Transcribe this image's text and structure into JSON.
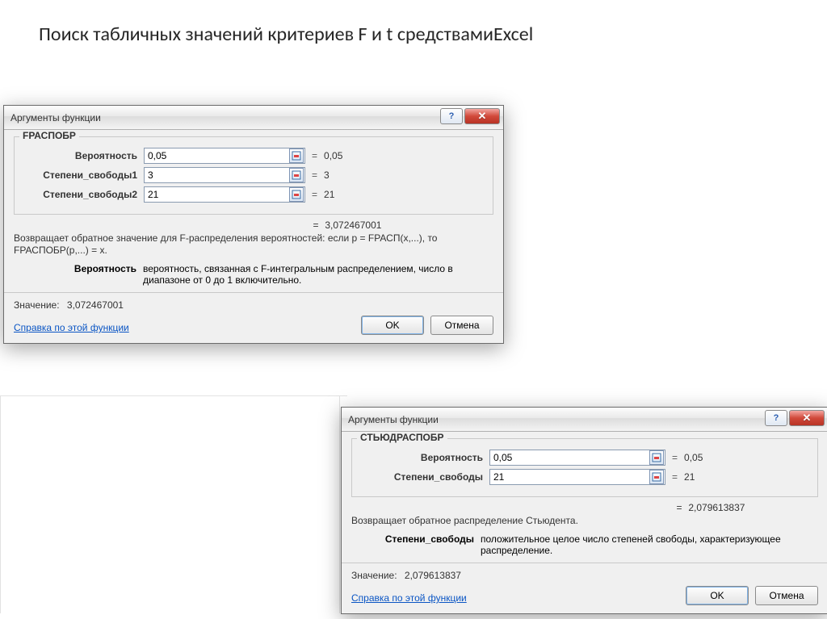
{
  "page_title": "Поиск табличных значений критериев F и t средствамиExcel",
  "dialog1": {
    "window_title": "Аргументы функции",
    "function_name": "FРАСПОБР",
    "args": [
      {
        "label": "Вероятность",
        "value": "0,05",
        "evaluated": "0,05"
      },
      {
        "label": "Степени_свободы1",
        "value": "3",
        "evaluated": "3"
      },
      {
        "label": "Степени_свободы2",
        "value": "21",
        "evaluated": "21"
      }
    ],
    "result_value": "3,072467001",
    "description": "Возвращает обратное значение для F-распределения вероятностей: если p = FРАСП(x,...), то FРАСПОБР(p,...) = x.",
    "param_label": "Вероятность",
    "param_text": "вероятность, связанная с F-интегральным распределением, число в диапазоне от 0 до 1 включительно.",
    "value_label": "Значение:",
    "value_text": "3,072467001",
    "help_link": "Справка по этой функции",
    "ok": "OK",
    "cancel": "Отмена",
    "eq": "="
  },
  "dialog2": {
    "window_title": "Аргументы функции",
    "function_name": "СТЬЮДРАСПОБР",
    "args": [
      {
        "label": "Вероятность",
        "value": "0,05",
        "evaluated": "0,05"
      },
      {
        "label": "Степени_свободы",
        "value": "21",
        "evaluated": "21"
      }
    ],
    "result_value": "2,079613837",
    "description": "Возвращает обратное распределение Стьюдента.",
    "param_label": "Степени_свободы",
    "param_text": "положительное целое число степеней свободы, характеризующее распределение.",
    "value_label": "Значение:",
    "value_text": "2,079613837",
    "help_link": "Справка по этой функции",
    "ok": "OK",
    "cancel": "Отмена",
    "eq": "="
  }
}
